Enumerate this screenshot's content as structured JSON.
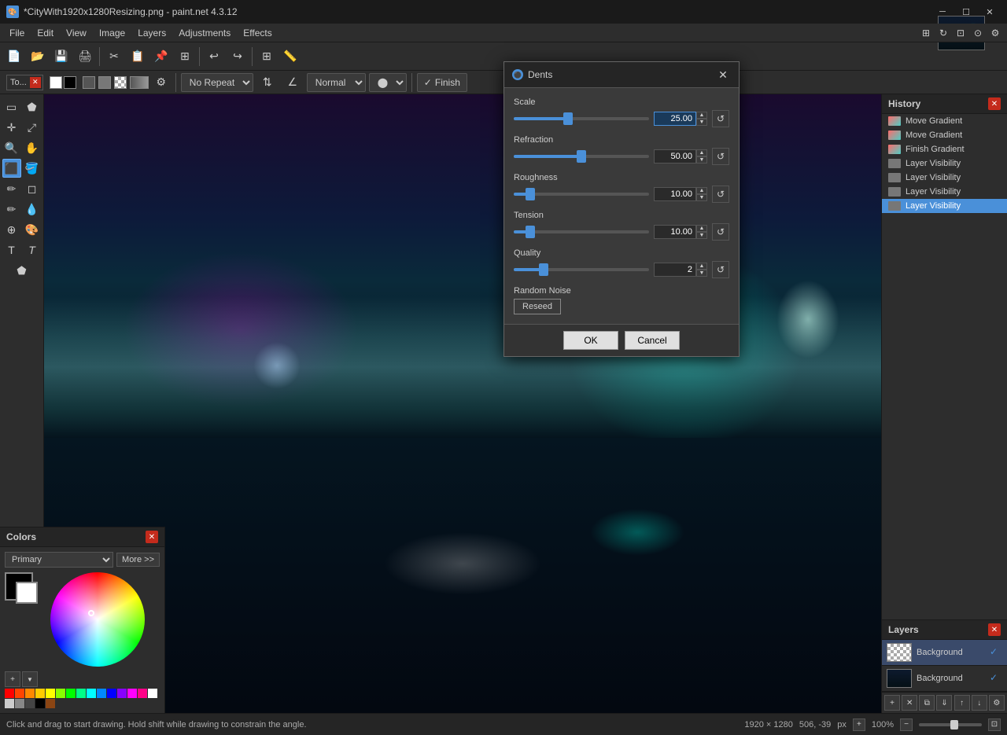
{
  "titlebar": {
    "title": "*CityWith1920x1280Resizing.png - paint.net 4.3.12",
    "icon": "🎨"
  },
  "menubar": {
    "items": [
      "File",
      "Edit",
      "View",
      "Image",
      "Layers",
      "Adjustments",
      "Effects"
    ]
  },
  "toolbar": {
    "no_repeat_label": "No Repeat",
    "normal_label": "Normal",
    "finish_label": "Finish"
  },
  "tool_options": {
    "tool_label": "To...",
    "normal_label": "Normal"
  },
  "dialog": {
    "title": "Dents",
    "params": [
      {
        "label": "Scale",
        "value": "25.00",
        "fill_pct": 40,
        "thumb_pct": 40
      },
      {
        "label": "Refraction",
        "value": "50.00",
        "fill_pct": 50,
        "thumb_pct": 50
      },
      {
        "label": "Roughness",
        "value": "10.00",
        "fill_pct": 12,
        "thumb_pct": 12
      },
      {
        "label": "Tension",
        "value": "10.00",
        "fill_pct": 12,
        "thumb_pct": 12
      },
      {
        "label": "Quality",
        "value": "2",
        "fill_pct": 22,
        "thumb_pct": 22
      }
    ],
    "random_noise_label": "Random Noise",
    "reseed_label": "Reseed",
    "ok_label": "OK",
    "cancel_label": "Cancel"
  },
  "history": {
    "title": "History",
    "items": [
      {
        "label": "Move Gradient"
      },
      {
        "label": "Move Gradient"
      },
      {
        "label": "Finish Gradient"
      },
      {
        "label": "Layer Visibility"
      },
      {
        "label": "Layer Visibility"
      },
      {
        "label": "Layer Visibility"
      },
      {
        "label": "Layer Visibility",
        "active": true
      }
    ]
  },
  "colors": {
    "title": "Colors",
    "primary_label": "Primary",
    "more_label": "More >>"
  },
  "layers": {
    "title": "Layers",
    "items": [
      {
        "name": "Background",
        "type": "gradient"
      },
      {
        "name": "Background",
        "type": "city"
      }
    ],
    "add_label": "+",
    "delete_label": "🗑",
    "up_label": "↑",
    "down_label": "↓"
  },
  "statusbar": {
    "tip": "Click and drag to start drawing. Hold shift while drawing to constrain the angle.",
    "dimensions": "1920 × 1280",
    "coords": "506, -39",
    "unit": "px",
    "zoom": "100%"
  },
  "palette_colors": [
    "#ff0000",
    "#ff8000",
    "#ffff00",
    "#80ff00",
    "#00ff00",
    "#00ff80",
    "#00ffff",
    "#0080ff",
    "#0000ff",
    "#8000ff",
    "#ff00ff",
    "#ff0080",
    "#ffffff",
    "#000000"
  ]
}
